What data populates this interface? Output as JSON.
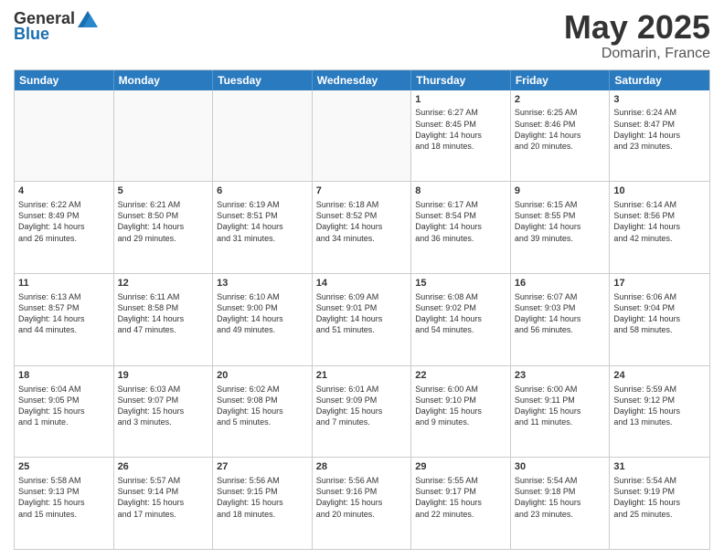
{
  "logo": {
    "general": "General",
    "blue": "Blue"
  },
  "title": "May 2025",
  "subtitle": "Domarin, France",
  "header_days": [
    "Sunday",
    "Monday",
    "Tuesday",
    "Wednesday",
    "Thursday",
    "Friday",
    "Saturday"
  ],
  "weeks": [
    [
      {
        "day": "",
        "text": "",
        "empty": true
      },
      {
        "day": "",
        "text": "",
        "empty": true
      },
      {
        "day": "",
        "text": "",
        "empty": true
      },
      {
        "day": "",
        "text": "",
        "empty": true
      },
      {
        "day": "1",
        "text": "Sunrise: 6:27 AM\nSunset: 8:45 PM\nDaylight: 14 hours\nand 18 minutes."
      },
      {
        "day": "2",
        "text": "Sunrise: 6:25 AM\nSunset: 8:46 PM\nDaylight: 14 hours\nand 20 minutes."
      },
      {
        "day": "3",
        "text": "Sunrise: 6:24 AM\nSunset: 8:47 PM\nDaylight: 14 hours\nand 23 minutes."
      }
    ],
    [
      {
        "day": "4",
        "text": "Sunrise: 6:22 AM\nSunset: 8:49 PM\nDaylight: 14 hours\nand 26 minutes."
      },
      {
        "day": "5",
        "text": "Sunrise: 6:21 AM\nSunset: 8:50 PM\nDaylight: 14 hours\nand 29 minutes."
      },
      {
        "day": "6",
        "text": "Sunrise: 6:19 AM\nSunset: 8:51 PM\nDaylight: 14 hours\nand 31 minutes."
      },
      {
        "day": "7",
        "text": "Sunrise: 6:18 AM\nSunset: 8:52 PM\nDaylight: 14 hours\nand 34 minutes."
      },
      {
        "day": "8",
        "text": "Sunrise: 6:17 AM\nSunset: 8:54 PM\nDaylight: 14 hours\nand 36 minutes."
      },
      {
        "day": "9",
        "text": "Sunrise: 6:15 AM\nSunset: 8:55 PM\nDaylight: 14 hours\nand 39 minutes."
      },
      {
        "day": "10",
        "text": "Sunrise: 6:14 AM\nSunset: 8:56 PM\nDaylight: 14 hours\nand 42 minutes."
      }
    ],
    [
      {
        "day": "11",
        "text": "Sunrise: 6:13 AM\nSunset: 8:57 PM\nDaylight: 14 hours\nand 44 minutes."
      },
      {
        "day": "12",
        "text": "Sunrise: 6:11 AM\nSunset: 8:58 PM\nDaylight: 14 hours\nand 47 minutes."
      },
      {
        "day": "13",
        "text": "Sunrise: 6:10 AM\nSunset: 9:00 PM\nDaylight: 14 hours\nand 49 minutes."
      },
      {
        "day": "14",
        "text": "Sunrise: 6:09 AM\nSunset: 9:01 PM\nDaylight: 14 hours\nand 51 minutes."
      },
      {
        "day": "15",
        "text": "Sunrise: 6:08 AM\nSunset: 9:02 PM\nDaylight: 14 hours\nand 54 minutes."
      },
      {
        "day": "16",
        "text": "Sunrise: 6:07 AM\nSunset: 9:03 PM\nDaylight: 14 hours\nand 56 minutes."
      },
      {
        "day": "17",
        "text": "Sunrise: 6:06 AM\nSunset: 9:04 PM\nDaylight: 14 hours\nand 58 minutes."
      }
    ],
    [
      {
        "day": "18",
        "text": "Sunrise: 6:04 AM\nSunset: 9:05 PM\nDaylight: 15 hours\nand 1 minute."
      },
      {
        "day": "19",
        "text": "Sunrise: 6:03 AM\nSunset: 9:07 PM\nDaylight: 15 hours\nand 3 minutes."
      },
      {
        "day": "20",
        "text": "Sunrise: 6:02 AM\nSunset: 9:08 PM\nDaylight: 15 hours\nand 5 minutes."
      },
      {
        "day": "21",
        "text": "Sunrise: 6:01 AM\nSunset: 9:09 PM\nDaylight: 15 hours\nand 7 minutes."
      },
      {
        "day": "22",
        "text": "Sunrise: 6:00 AM\nSunset: 9:10 PM\nDaylight: 15 hours\nand 9 minutes."
      },
      {
        "day": "23",
        "text": "Sunrise: 6:00 AM\nSunset: 9:11 PM\nDaylight: 15 hours\nand 11 minutes."
      },
      {
        "day": "24",
        "text": "Sunrise: 5:59 AM\nSunset: 9:12 PM\nDaylight: 15 hours\nand 13 minutes."
      }
    ],
    [
      {
        "day": "25",
        "text": "Sunrise: 5:58 AM\nSunset: 9:13 PM\nDaylight: 15 hours\nand 15 minutes."
      },
      {
        "day": "26",
        "text": "Sunrise: 5:57 AM\nSunset: 9:14 PM\nDaylight: 15 hours\nand 17 minutes."
      },
      {
        "day": "27",
        "text": "Sunrise: 5:56 AM\nSunset: 9:15 PM\nDaylight: 15 hours\nand 18 minutes."
      },
      {
        "day": "28",
        "text": "Sunrise: 5:56 AM\nSunset: 9:16 PM\nDaylight: 15 hours\nand 20 minutes."
      },
      {
        "day": "29",
        "text": "Sunrise: 5:55 AM\nSunset: 9:17 PM\nDaylight: 15 hours\nand 22 minutes."
      },
      {
        "day": "30",
        "text": "Sunrise: 5:54 AM\nSunset: 9:18 PM\nDaylight: 15 hours\nand 23 minutes."
      },
      {
        "day": "31",
        "text": "Sunrise: 5:54 AM\nSunset: 9:19 PM\nDaylight: 15 hours\nand 25 minutes."
      }
    ]
  ]
}
